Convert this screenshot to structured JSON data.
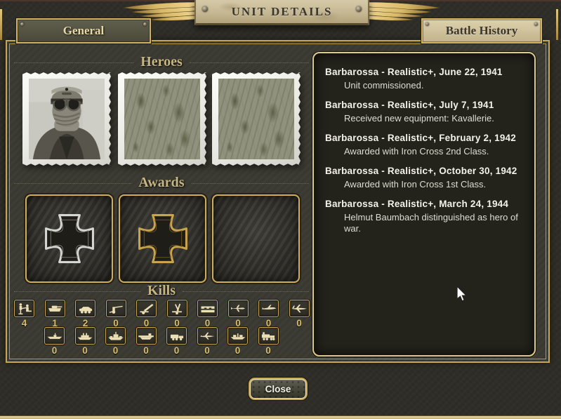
{
  "window": {
    "title": "UNIT DETAILS",
    "close_label": "Close"
  },
  "tabs": [
    {
      "id": "general",
      "label": "General",
      "active": false
    },
    {
      "id": "battle-history",
      "label": "Battle History",
      "active": true
    }
  ],
  "heroes": {
    "heading": "Heroes",
    "slots": [
      {
        "filled": true,
        "content": "hero portrait photograph"
      },
      {
        "filled": false,
        "content": "empty photo slot"
      },
      {
        "filled": false,
        "content": "empty photo slot"
      }
    ]
  },
  "awards": {
    "heading": "Awards",
    "slots": [
      {
        "filled": true,
        "award": "Iron Cross 2nd Class"
      },
      {
        "filled": true,
        "award": "Iron Cross 1st Class"
      },
      {
        "filled": false,
        "award": ""
      }
    ]
  },
  "kills": {
    "heading": "Kills",
    "row1": [
      {
        "type": "infantry",
        "count": 4
      },
      {
        "type": "tank",
        "count": 1
      },
      {
        "type": "recon",
        "count": 2
      },
      {
        "type": "anti-tank",
        "count": 0
      },
      {
        "type": "artillery",
        "count": 0
      },
      {
        "type": "anti-air",
        "count": 0
      },
      {
        "type": "fortification",
        "count": 0
      },
      {
        "type": "fighter",
        "count": 0
      },
      {
        "type": "tactical-bomber",
        "count": 0
      },
      {
        "type": "strategic-bomber",
        "count": 0
      }
    ],
    "row2": [
      {
        "type": "submarine",
        "count": 0
      },
      {
        "type": "destroyer",
        "count": 0
      },
      {
        "type": "capital-ship",
        "count": 0
      },
      {
        "type": "aircraft-carrier",
        "count": 0
      },
      {
        "type": "land-transport",
        "count": 0
      },
      {
        "type": "air-transport",
        "count": 0
      },
      {
        "type": "sea-transport",
        "count": 0
      },
      {
        "type": "armored-train",
        "count": 0
      }
    ]
  },
  "battle_history": {
    "entries": [
      {
        "header": "Barbarossa - Realistic+, June 22, 1941",
        "detail": "Unit commissioned."
      },
      {
        "header": "Barbarossa - Realistic+, July 7, 1941",
        "detail": "Received new equipment: Kavallerie."
      },
      {
        "header": "Barbarossa - Realistic+, February 2, 1942",
        "detail": "Awarded with Iron Cross 2nd Class."
      },
      {
        "header": "Barbarossa - Realistic+, October 30, 1942",
        "detail": "Awarded with Iron Cross 1st Class."
      },
      {
        "header": "Barbarossa - Realistic+, March 24, 1944",
        "detail": "Helmut Baumbach distinguished as hero of war."
      }
    ]
  },
  "colors": {
    "gold": "#c9a855",
    "parchment": "#cfc2a0",
    "heading_tan": "#c6b584",
    "panel_bg": "#3a3932",
    "history_bg": "#23221b",
    "kill_number": "#d7bd6d"
  }
}
